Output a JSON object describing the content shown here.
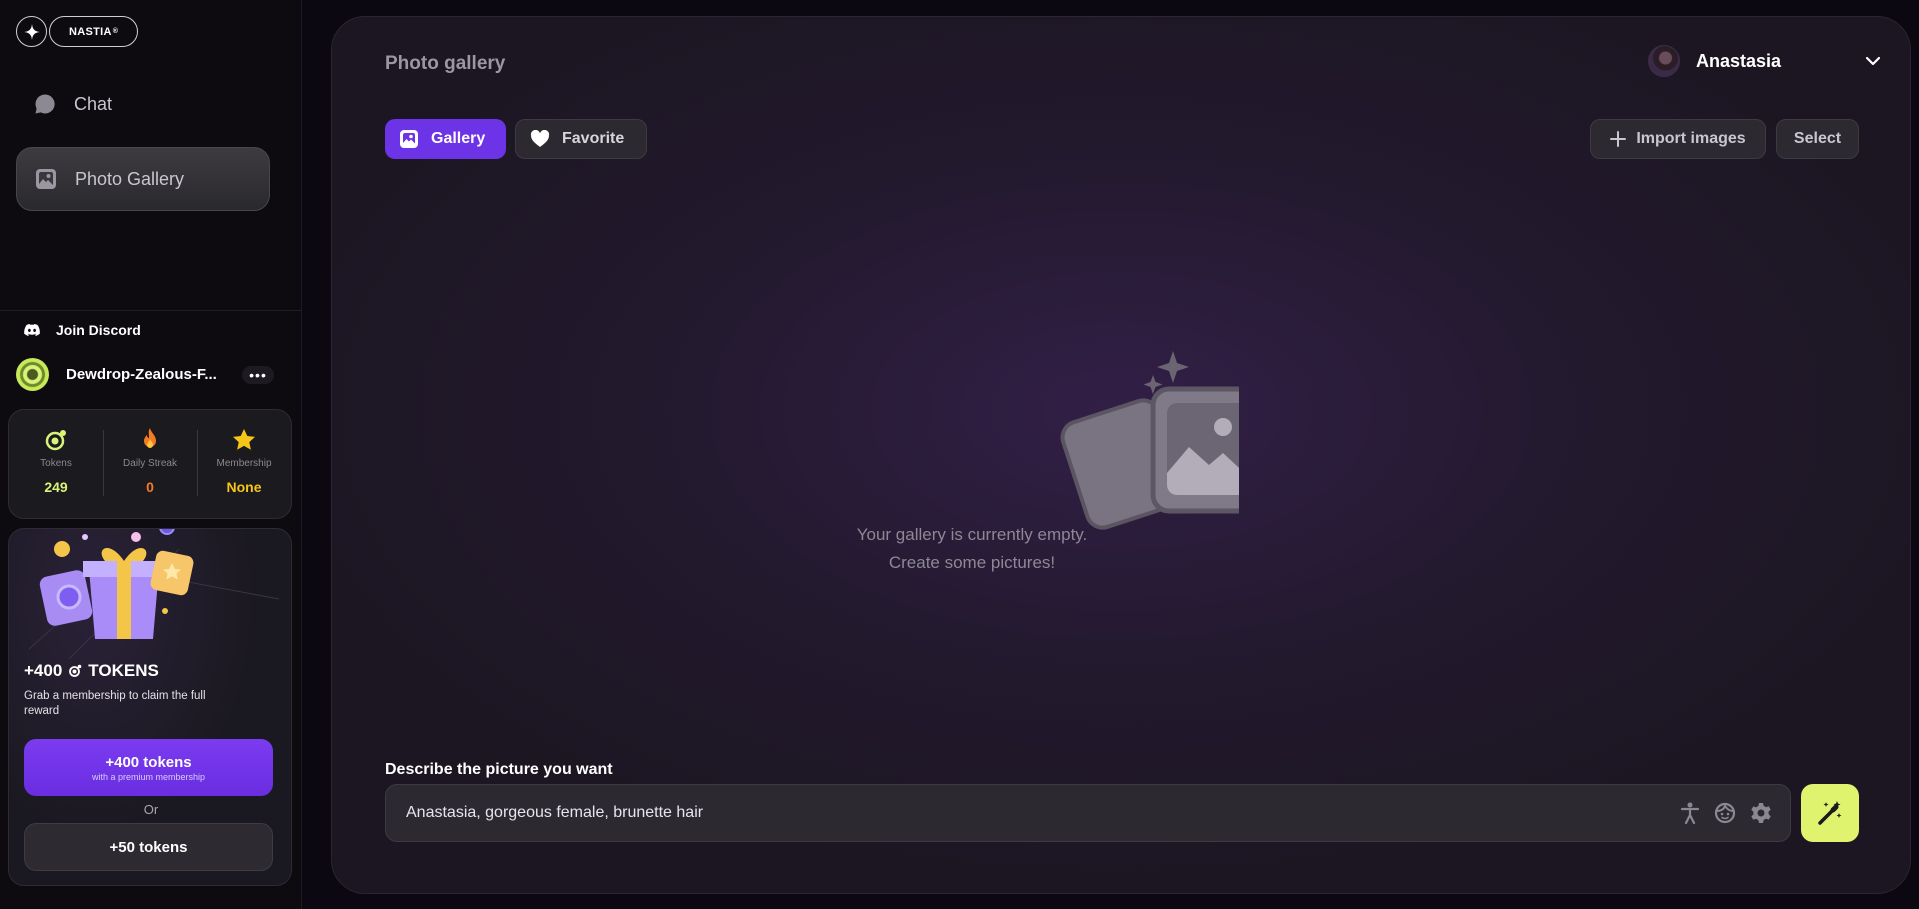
{
  "brand": {
    "name": "NASTIA",
    "mark": "®"
  },
  "sidebar": {
    "nav": [
      {
        "label": "Chat",
        "icon": "chat-bubble-icon"
      },
      {
        "label": "Photo Gallery",
        "icon": "photo-icon",
        "active": true
      }
    ],
    "discord_label": "Join Discord",
    "user": {
      "name": "Dewdrop-Zealous-F...",
      "more": "•••"
    },
    "stats": [
      {
        "label": "Tokens",
        "value": "249",
        "icon": "token-icon",
        "color": "#d9f37a"
      },
      {
        "label": "Daily Streak",
        "value": "0",
        "icon": "fire-icon",
        "color": "#f47a23"
      },
      {
        "label": "Membership",
        "value": "None",
        "icon": "star-icon",
        "color": "#f5c518"
      }
    ],
    "promo": {
      "title_prefix": "+400",
      "title_suffix": "TOKENS",
      "description": "Grab a membership to claim the full reward",
      "primary_button": {
        "label": "+400 tokens",
        "sublabel": "with a premium membership"
      },
      "or_text": "Or",
      "secondary_button": {
        "label": "+50 tokens"
      }
    }
  },
  "main": {
    "title": "Photo gallery",
    "account": {
      "name": "Anastasia"
    },
    "tabs": [
      {
        "label": "Gallery",
        "active": true,
        "icon": "gallery-icon"
      },
      {
        "label": "Favorite",
        "active": false,
        "icon": "heart-icon"
      }
    ],
    "actions": {
      "import_label": "Import images",
      "select_label": "Select"
    },
    "empty_state": {
      "line1": "Your gallery is currently empty.",
      "line2": "Create some pictures!"
    },
    "prompt": {
      "label": "Describe the picture you want",
      "value": "Anastasia, gorgeous female, brunette hair",
      "icons": [
        "pose-icon",
        "face-icon",
        "settings-icon"
      ]
    }
  },
  "colors": {
    "accent": "#6d33e6",
    "generate": "#dff36e",
    "tokens": "#d9f37a",
    "streak": "#f47a23",
    "membership": "#f5c518"
  }
}
